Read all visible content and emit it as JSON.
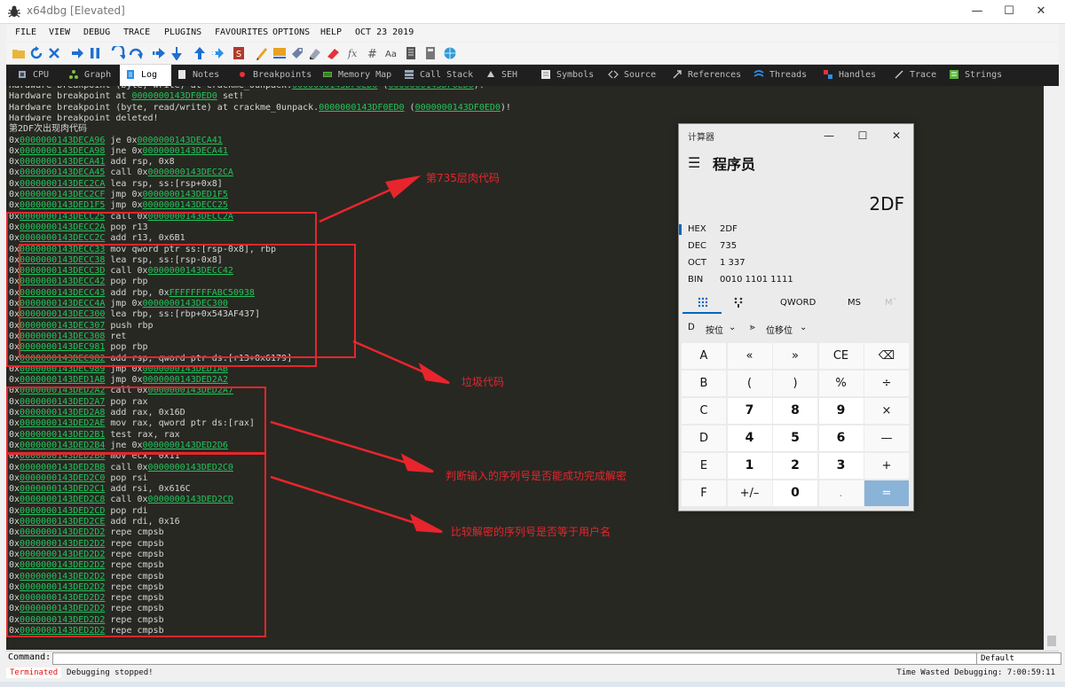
{
  "window": {
    "title": "x64dbg [Elevated]",
    "controls": {
      "minimize": "—",
      "maximize": "☐",
      "close": "✕"
    }
  },
  "menu": [
    "FILE",
    "VIEW",
    "DEBUG",
    "TRACE",
    "PLUGINS",
    "FAVOURITES",
    "OPTIONS",
    "HELP",
    "OCT 23 2019"
  ],
  "toolbar": {
    "icons": [
      "open-icon",
      "restart-icon",
      "close-icon",
      "run-icon",
      "pause-icon",
      "step-into-icon",
      "step-over-icon",
      "trace-into-icon",
      "trace-over-icon",
      "execute-till-return-icon",
      "run-to-user-code-icon",
      "scylla-icon",
      "patch-icon",
      "comments-icon",
      "labels-icon",
      "bookmarks-icon",
      "functions-icon",
      "fx-icon",
      "hash-icon",
      "font-icon",
      "script-icon",
      "calculator-icon",
      "globe-icon"
    ]
  },
  "tabs": [
    {
      "label": "CPU",
      "icon": "cpu-icon"
    },
    {
      "label": "Graph",
      "icon": "graph-icon"
    },
    {
      "label": "Log",
      "icon": "log-icon"
    },
    {
      "label": "Notes",
      "icon": "notes-icon"
    },
    {
      "label": "Breakpoints",
      "icon": "breakpoint-icon"
    },
    {
      "label": "Memory Map",
      "icon": "memory-map-icon"
    },
    {
      "label": "Call Stack",
      "icon": "call-stack-icon"
    },
    {
      "label": "SEH",
      "icon": "seh-icon"
    },
    {
      "label": "Symbols",
      "icon": "symbols-icon"
    },
    {
      "label": "Source",
      "icon": "source-icon"
    },
    {
      "label": "References",
      "icon": "references-icon"
    },
    {
      "label": "Threads",
      "icon": "threads-icon"
    },
    {
      "label": "Handles",
      "icon": "handles-icon"
    },
    {
      "label": "Trace",
      "icon": "trace-icon"
    },
    {
      "label": "Strings",
      "icon": "strings-icon"
    }
  ],
  "log": {
    "lines": [
      [
        {
          "t": "Hardware breakpoint (byte, write) at crackme_0unpack."
        },
        {
          "t": "0000000143DF0ED0",
          "l": 1
        },
        {
          "t": " ("
        },
        {
          "t": "0000000143DF0ED0",
          "l": 1
        },
        {
          "t": ")!"
        }
      ],
      [
        {
          "t": "Hardware breakpoint at "
        },
        {
          "t": "0000000143DF0ED0",
          "l": 1
        },
        {
          "t": " set!"
        }
      ],
      [
        {
          "t": "Hardware breakpoint (byte, read/write) at crackme_0unpack."
        },
        {
          "t": "0000000143DF0ED0",
          "l": 1
        },
        {
          "t": " ("
        },
        {
          "t": "0000000143DF0ED0",
          "l": 1
        },
        {
          "t": ")!"
        }
      ],
      [
        {
          "t": "Hardware breakpoint deleted!"
        }
      ],
      [
        {
          "t": "第2DF次出现肉代码"
        }
      ],
      [
        {
          "t": "0x"
        },
        {
          "t": "0000000143DECA96",
          "l": 1
        },
        {
          "t": " je 0x"
        },
        {
          "t": "0000000143DECA41",
          "l": 1
        }
      ],
      [
        {
          "t": "0x"
        },
        {
          "t": "0000000143DECA98",
          "l": 1
        },
        {
          "t": " jne 0x"
        },
        {
          "t": "0000000143DECA41",
          "l": 1
        }
      ],
      [
        {
          "t": "0x"
        },
        {
          "t": "0000000143DECA41",
          "l": 1
        },
        {
          "t": " add rsp, 0x8"
        }
      ],
      [
        {
          "t": "0x"
        },
        {
          "t": "0000000143DECA45",
          "l": 1
        },
        {
          "t": " call 0x"
        },
        {
          "t": "0000000143DEC2CA",
          "l": 1
        }
      ],
      [
        {
          "t": "0x"
        },
        {
          "t": "0000000143DEC2CA",
          "l": 1
        },
        {
          "t": " lea rsp, ss:[rsp+0x8]"
        }
      ],
      [
        {
          "t": "0x"
        },
        {
          "t": "0000000143DEC2CF",
          "l": 1
        },
        {
          "t": " jmp 0x"
        },
        {
          "t": "0000000143DED1F5",
          "l": 1
        }
      ],
      [
        {
          "t": "0x"
        },
        {
          "t": "0000000143DED1F5",
          "l": 1
        },
        {
          "t": " jmp 0x"
        },
        {
          "t": "0000000143DECC25",
          "l": 1
        }
      ],
      [
        {
          "t": "0x"
        },
        {
          "t": "0000000143DECC25",
          "l": 1
        },
        {
          "t": " call 0x"
        },
        {
          "t": "0000000143DECC2A",
          "l": 1
        }
      ],
      [
        {
          "t": "0x"
        },
        {
          "t": "0000000143DECC2A",
          "l": 1
        },
        {
          "t": " pop r13"
        }
      ],
      [
        {
          "t": "0x"
        },
        {
          "t": "0000000143DECC2C",
          "l": 1
        },
        {
          "t": " add r13, 0x6B1"
        }
      ],
      [
        {
          "t": "0x"
        },
        {
          "t": "0000000143DECC33",
          "l": 1
        },
        {
          "t": " mov qword ptr ss:[rsp-0x8], rbp"
        }
      ],
      [
        {
          "t": "0x"
        },
        {
          "t": "0000000143DECC38",
          "l": 1
        },
        {
          "t": " lea rsp, ss:[rsp-0x8]"
        }
      ],
      [
        {
          "t": "0x"
        },
        {
          "t": "0000000143DECC3D",
          "l": 1
        },
        {
          "t": " call 0x"
        },
        {
          "t": "0000000143DECC42",
          "l": 1
        }
      ],
      [
        {
          "t": "0x"
        },
        {
          "t": "0000000143DECC42",
          "l": 1
        },
        {
          "t": " pop rbp"
        }
      ],
      [
        {
          "t": "0x"
        },
        {
          "t": "0000000143DECC43",
          "l": 1
        },
        {
          "t": " add rbp, 0x"
        },
        {
          "t": "FFFFFFFFABC50938",
          "l": 1
        }
      ],
      [
        {
          "t": "0x"
        },
        {
          "t": "0000000143DECC4A",
          "l": 1
        },
        {
          "t": " jmp 0x"
        },
        {
          "t": "0000000143DEC300",
          "l": 1
        }
      ],
      [
        {
          "t": "0x"
        },
        {
          "t": "0000000143DEC300",
          "l": 1
        },
        {
          "t": " lea rbp, ss:[rbp+0x543AF437]"
        }
      ],
      [
        {
          "t": "0x"
        },
        {
          "t": "0000000143DEC307",
          "l": 1
        },
        {
          "t": " push rbp"
        }
      ],
      [
        {
          "t": "0x"
        },
        {
          "t": "0000000143DEC308",
          "l": 1
        },
        {
          "t": " ret"
        }
      ],
      [
        {
          "t": "0x"
        },
        {
          "t": "0000000143DEC981",
          "l": 1
        },
        {
          "t": " pop rbp"
        }
      ],
      [
        {
          "t": "0x"
        },
        {
          "t": "0000000143DEC982",
          "l": 1
        },
        {
          "t": " add rsp, qword ptr ds:[r13+0x6179]"
        }
      ],
      [
        {
          "t": "0x"
        },
        {
          "t": "0000000143DEC989",
          "l": 1
        },
        {
          "t": " jmp 0x"
        },
        {
          "t": "0000000143DED1AB",
          "l": 1
        }
      ],
      [
        {
          "t": "0x"
        },
        {
          "t": "0000000143DED1AB",
          "l": 1
        },
        {
          "t": " jmp 0x"
        },
        {
          "t": "0000000143DED2A2",
          "l": 1
        }
      ],
      [
        {
          "t": "0x"
        },
        {
          "t": "0000000143DED2A2",
          "l": 1
        },
        {
          "t": " call 0x"
        },
        {
          "t": "0000000143DED2A7",
          "l": 1
        }
      ],
      [
        {
          "t": "0x"
        },
        {
          "t": "0000000143DED2A7",
          "l": 1
        },
        {
          "t": " pop rax"
        }
      ],
      [
        {
          "t": "0x"
        },
        {
          "t": "0000000143DED2A8",
          "l": 1
        },
        {
          "t": " add rax, 0x16D"
        }
      ],
      [
        {
          "t": "0x"
        },
        {
          "t": "0000000143DED2AE",
          "l": 1
        },
        {
          "t": " mov rax, qword ptr ds:[rax]"
        }
      ],
      [
        {
          "t": "0x"
        },
        {
          "t": "0000000143DED2B1",
          "l": 1
        },
        {
          "t": " test rax, rax"
        }
      ],
      [
        {
          "t": "0x"
        },
        {
          "t": "0000000143DED2B4",
          "l": 1
        },
        {
          "t": " jne 0x"
        },
        {
          "t": "0000000143DED2D6",
          "l": 1
        }
      ],
      [
        {
          "t": "0x"
        },
        {
          "t": "0000000143DED2B6",
          "l": 1
        },
        {
          "t": " mov ecx, 0x11"
        }
      ],
      [
        {
          "t": "0x"
        },
        {
          "t": "0000000143DED2BB",
          "l": 1
        },
        {
          "t": " call 0x"
        },
        {
          "t": "0000000143DED2C0",
          "l": 1
        }
      ],
      [
        {
          "t": "0x"
        },
        {
          "t": "0000000143DED2C0",
          "l": 1
        },
        {
          "t": " pop rsi"
        }
      ],
      [
        {
          "t": "0x"
        },
        {
          "t": "0000000143DED2C1",
          "l": 1
        },
        {
          "t": " add rsi, 0x616C"
        }
      ],
      [
        {
          "t": "0x"
        },
        {
          "t": "0000000143DED2C8",
          "l": 1
        },
        {
          "t": " call 0x"
        },
        {
          "t": "0000000143DED2CD",
          "l": 1
        }
      ],
      [
        {
          "t": "0x"
        },
        {
          "t": "0000000143DED2CD",
          "l": 1
        },
        {
          "t": " pop rdi"
        }
      ],
      [
        {
          "t": "0x"
        },
        {
          "t": "0000000143DED2CE",
          "l": 1
        },
        {
          "t": " add rdi, 0x16"
        }
      ],
      [
        {
          "t": "0x"
        },
        {
          "t": "0000000143DED2D2",
          "l": 1
        },
        {
          "t": " repe cmpsb"
        }
      ],
      [
        {
          "t": "0x"
        },
        {
          "t": "0000000143DED2D2",
          "l": 1
        },
        {
          "t": " repe cmpsb"
        }
      ],
      [
        {
          "t": "0x"
        },
        {
          "t": "0000000143DED2D2",
          "l": 1
        },
        {
          "t": " repe cmpsb"
        }
      ],
      [
        {
          "t": "0x"
        },
        {
          "t": "0000000143DED2D2",
          "l": 1
        },
        {
          "t": " repe cmpsb"
        }
      ],
      [
        {
          "t": "0x"
        },
        {
          "t": "0000000143DED2D2",
          "l": 1
        },
        {
          "t": " repe cmpsb"
        }
      ],
      [
        {
          "t": "0x"
        },
        {
          "t": "0000000143DED2D2",
          "l": 1
        },
        {
          "t": " repe cmpsb"
        }
      ],
      [
        {
          "t": "0x"
        },
        {
          "t": "0000000143DED2D2",
          "l": 1
        },
        {
          "t": " repe cmpsb"
        }
      ],
      [
        {
          "t": "0x"
        },
        {
          "t": "0000000143DED2D2",
          "l": 1
        },
        {
          "t": " repe cmpsb"
        }
      ],
      [
        {
          "t": "0x"
        },
        {
          "t": "0000000143DED2D2",
          "l": 1
        },
        {
          "t": " repe cmpsb"
        }
      ],
      [
        {
          "t": "0x"
        },
        {
          "t": "0000000143DED2D2",
          "l": 1
        },
        {
          "t": " repe cmpsb"
        }
      ]
    ]
  },
  "annotations": {
    "a1": "第735层肉代码",
    "a2": "垃圾代码",
    "a3": "判断输入的序列号是否能成功完成解密",
    "a4": "比较解密的序列号是否等于用户名"
  },
  "command": {
    "label": "Command:",
    "value": "",
    "dropdown": "Default"
  },
  "status": {
    "state": "Terminated",
    "message": "Debugging stopped!",
    "time": "Time Wasted Debugging: 7:00:59:11"
  },
  "calculator": {
    "title": "计算器",
    "mode": "程序员",
    "display": "2DF",
    "radix": [
      {
        "name": "HEX",
        "value": "2DF"
      },
      {
        "name": "DEC",
        "value": "735"
      },
      {
        "name": "OCT",
        "value": "1 337"
      },
      {
        "name": "BIN",
        "value": "0010 1101 1111"
      }
    ],
    "word_size": "QWORD",
    "ms": "MS",
    "mplus": "Mˇ",
    "bitwise": "按位",
    "bitshift": "位移位",
    "keys": [
      [
        "A",
        "«",
        "»",
        "CE",
        "⌫"
      ],
      [
        "B",
        "(",
        ")",
        "%",
        "÷"
      ],
      [
        "C",
        "7",
        "8",
        "9",
        "×"
      ],
      [
        "D",
        "4",
        "5",
        "6",
        "—"
      ],
      [
        "E",
        "1",
        "2",
        "3",
        "+"
      ],
      [
        "F",
        "+/–",
        "0",
        ".",
        "="
      ]
    ]
  },
  "colors": {
    "log_bg": "#272822",
    "link": "#22c45b",
    "annotation": "#e8252d",
    "accent": "#0067c0"
  }
}
